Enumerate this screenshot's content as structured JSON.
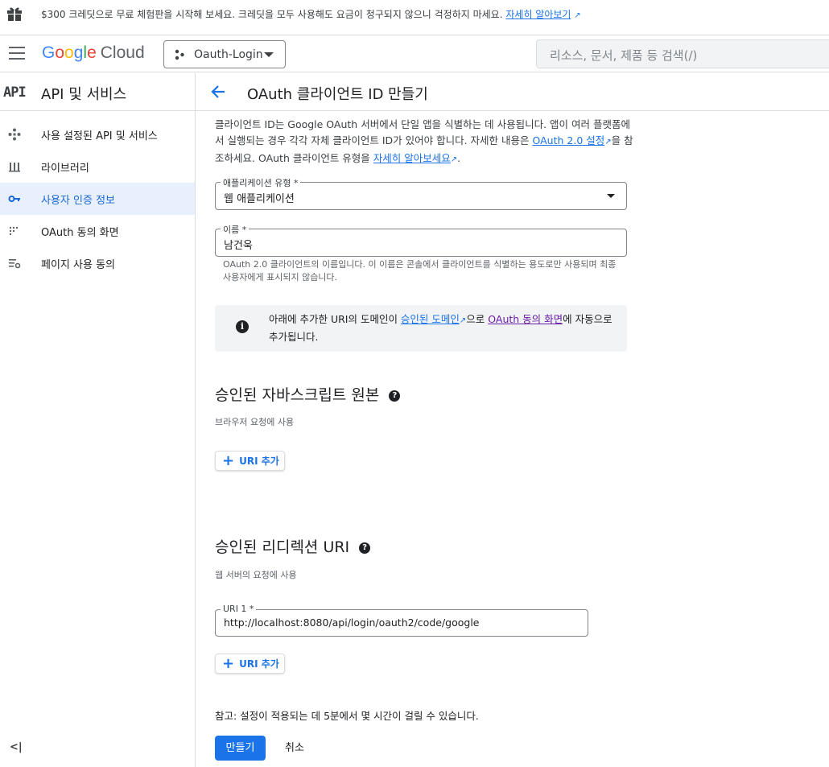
{
  "banner": {
    "text": "$300 크레딧으로 무료 체험판을 시작해 보세요. 크레딧을 모두 사용해도 요금이 청구되지 않으니 걱정하지 마세요.",
    "link": "자세히 알아보기"
  },
  "header": {
    "logo_google": [
      "G",
      "o",
      "o",
      "g",
      "l",
      "e"
    ],
    "logo_cloud": "Cloud",
    "project": "Oauth-Login",
    "search_placeholder": "리소스, 문서, 제품 등 검색(/)"
  },
  "sidebar": {
    "badge": "API",
    "title": "API 및 서비스",
    "items": [
      {
        "label": "사용 설정된 API 및 서비스",
        "icon": "api-diamond-icon"
      },
      {
        "label": "라이브러리",
        "icon": "library-icon"
      },
      {
        "label": "사용자 인증 정보",
        "icon": "key-icon",
        "active": true
      },
      {
        "label": "OAuth 동의 화면",
        "icon": "consent-dots-icon"
      },
      {
        "label": "페이지 사용 동의",
        "icon": "settings-list-icon"
      }
    ],
    "collapse": "<|"
  },
  "page": {
    "title": "OAuth 클라이언트 ID 만들기",
    "intro_1": "클라이언트 ID는 Google OAuth 서버에서 단일 앱을 식별하는 데 사용됩니다. 앱이 여러 플랫폼에서 실행되는 경우 각각 자체 클라이언트 ID가 있어야 합니다. 자세한 내용은 ",
    "intro_link_1": "OAuth 2.0 설정",
    "intro_2": "을 참조하세요. OAuth 클라이언트 유형을 ",
    "intro_link_2": "자세히 알아보세요",
    "intro_3": "."
  },
  "form": {
    "app_type_label": "애플리케이션 유형 *",
    "app_type_value": "웹 애플리케이션",
    "name_label": "이름 *",
    "name_value": "남건욱",
    "name_hint": "OAuth 2.0 클라이언트의 이름입니다. 이 이름은 콘솔에서 클라이언트를 식별하는 용도로만 사용되며 최종 사용자에게 표시되지 않습니다."
  },
  "info": {
    "t1": "아래에 추가한 URI의 도메인이 ",
    "link1": "승인된 도메인",
    "t2": "으로 ",
    "link2": "OAuth 동의 화면",
    "t3": "에 자동으로 추가됩니다."
  },
  "js_origins": {
    "title": "승인된 자바스크립트 원본",
    "subtitle": "브라우저 요청에 사용",
    "add_label": "URI 추가"
  },
  "redirect": {
    "title": "승인된 리디렉션 URI",
    "subtitle": "웹 서버의 요청에 사용",
    "uri_label": "URI 1 *",
    "uri_value": "http://localhost:8080/api/login/oauth2/code/google",
    "add_label": "URI 추가"
  },
  "footer": {
    "note": "참고: 설정이 적용되는 데 5분에서 몇 시간이 걸릴 수 있습니다.",
    "create": "만들기",
    "cancel": "취소"
  },
  "colors": {
    "accent": "#1a73e8",
    "active_bg": "#e8f0fe",
    "visited_link": "#681da8"
  }
}
